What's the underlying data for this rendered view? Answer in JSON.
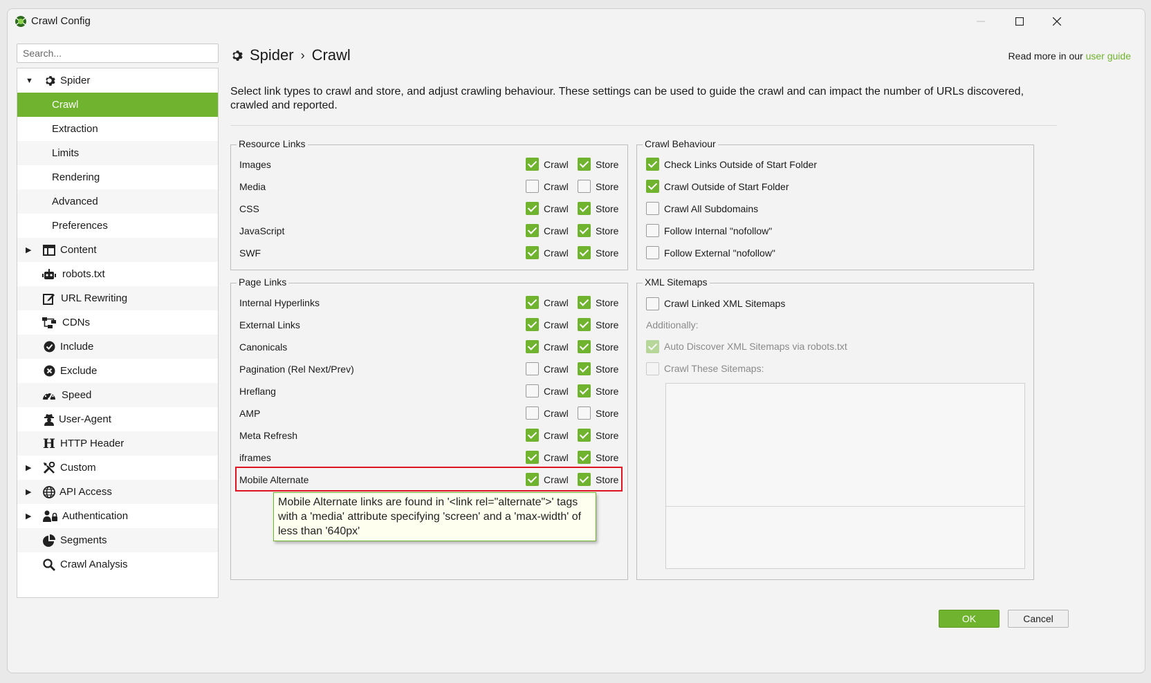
{
  "window": {
    "title": "Crawl Config"
  },
  "sidebar": {
    "search_placeholder": "Search...",
    "items": [
      {
        "label": "Spider",
        "icon": "gear-icon",
        "expanded": true
      },
      {
        "label": "Crawl",
        "active": true
      },
      {
        "label": "Extraction"
      },
      {
        "label": "Limits"
      },
      {
        "label": "Rendering"
      },
      {
        "label": "Advanced"
      },
      {
        "label": "Preferences"
      },
      {
        "label": "Content",
        "icon": "window-icon",
        "collapsed": true
      },
      {
        "label": "robots.txt",
        "icon": "robot-icon"
      },
      {
        "label": "URL Rewriting",
        "icon": "edit-icon"
      },
      {
        "label": "CDNs",
        "icon": "network-icon"
      },
      {
        "label": "Include",
        "icon": "check-circle-icon"
      },
      {
        "label": "Exclude",
        "icon": "x-circle-icon"
      },
      {
        "label": "Speed",
        "icon": "speedometer-icon"
      },
      {
        "label": "User-Agent",
        "icon": "user-secret-icon"
      },
      {
        "label": "HTTP Header",
        "icon": "header-h-icon"
      },
      {
        "label": "Custom",
        "icon": "tools-icon",
        "collapsed": true
      },
      {
        "label": "API Access",
        "icon": "globe-icon",
        "collapsed": true
      },
      {
        "label": "Authentication",
        "icon": "users-lock-icon",
        "collapsed": true
      },
      {
        "label": "Segments",
        "icon": "pie-chart-icon"
      },
      {
        "label": "Crawl Analysis",
        "icon": "search-icon"
      }
    ]
  },
  "header": {
    "breadcrumb_parent": "Spider",
    "breadcrumb_sep": "›",
    "breadcrumb_current": "Crawl",
    "read_more": "Read more in our ",
    "user_guide": "user guide",
    "description": "Select link types to crawl and store, and adjust crawling behaviour. These settings can be used to guide the crawl and can impact the number of URLs discovered, crawled and reported."
  },
  "resource_links": {
    "title": "Resource Links",
    "crawl_label": "Crawl",
    "store_label": "Store",
    "rows": [
      {
        "label": "Images",
        "crawl": true,
        "store": true
      },
      {
        "label": "Media",
        "crawl": false,
        "store": false
      },
      {
        "label": "CSS",
        "crawl": true,
        "store": true
      },
      {
        "label": "JavaScript",
        "crawl": true,
        "store": true
      },
      {
        "label": "SWF",
        "crawl": true,
        "store": true
      }
    ]
  },
  "page_links": {
    "title": "Page Links",
    "crawl_label": "Crawl",
    "store_label": "Store",
    "rows": [
      {
        "label": "Internal Hyperlinks",
        "crawl": true,
        "store": true
      },
      {
        "label": "External Links",
        "crawl": true,
        "store": true
      },
      {
        "label": "Canonicals",
        "crawl": true,
        "store": true
      },
      {
        "label": "Pagination (Rel Next/Prev)",
        "crawl": false,
        "store": true
      },
      {
        "label": "Hreflang",
        "crawl": false,
        "store": true
      },
      {
        "label": "AMP",
        "crawl": false,
        "store": false
      },
      {
        "label": "Meta Refresh",
        "crawl": true,
        "store": true
      },
      {
        "label": "iframes",
        "crawl": true,
        "store": true
      },
      {
        "label": "Mobile Alternate",
        "crawl": true,
        "store": true
      }
    ]
  },
  "tooltip": {
    "text": "Mobile Alternate links are found in '<link rel=\"alternate\">' tags with a 'media' attribute specifying 'screen' and a 'max-width' of less than '640px'"
  },
  "crawl_behaviour": {
    "title": "Crawl Behaviour",
    "rows": [
      {
        "label": "Check Links Outside of Start Folder",
        "checked": true
      },
      {
        "label": "Crawl Outside of Start Folder",
        "checked": true
      },
      {
        "label": "Crawl All Subdomains",
        "checked": false
      },
      {
        "label": "Follow Internal \"nofollow\"",
        "checked": false
      },
      {
        "label": "Follow External \"nofollow\"",
        "checked": false
      }
    ]
  },
  "xml_sitemaps": {
    "title": "XML Sitemaps",
    "crawl_linked": {
      "label": "Crawl Linked XML Sitemaps",
      "checked": false
    },
    "additionally": "Additionally:",
    "auto_discover": {
      "label": "Auto Discover XML Sitemaps via robots.txt",
      "checked": true,
      "disabled": true
    },
    "crawl_these": {
      "label": "Crawl These Sitemaps:",
      "checked": false,
      "disabled": true
    }
  },
  "footer": {
    "ok_label": "OK",
    "cancel_label": "Cancel"
  },
  "colors": {
    "accent": "#6fb32e",
    "highlight": "#e0141e"
  }
}
